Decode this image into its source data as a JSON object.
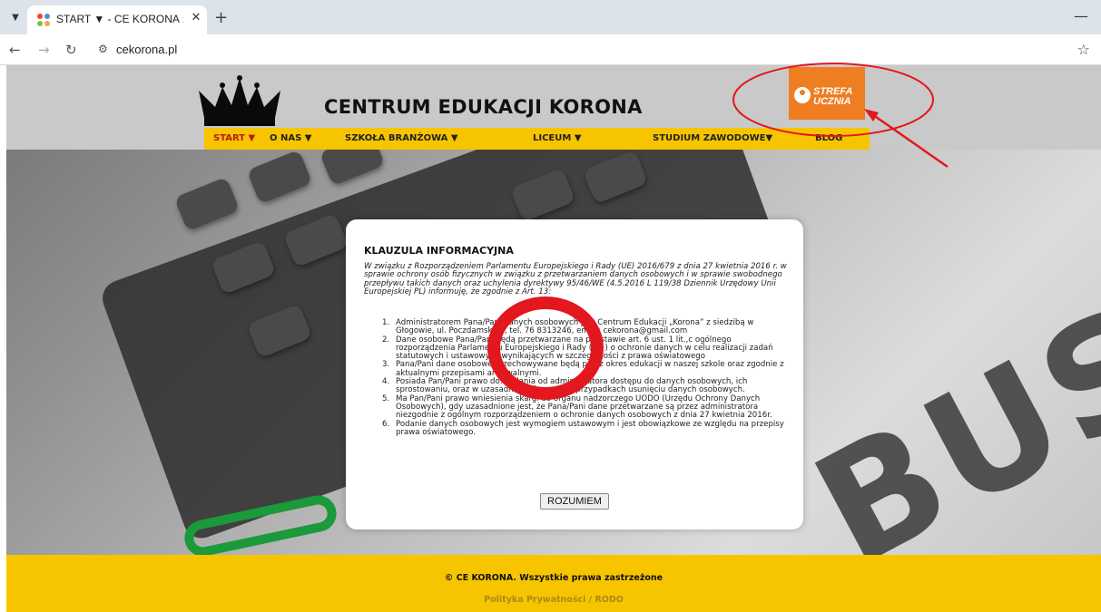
{
  "browser": {
    "tab_title": "START ▼ - CE KORONA :: CENT",
    "url": "cekorona.pl",
    "tab_menu_icon": "chevron-down-icon",
    "close_icon": "close-icon",
    "new_tab_icon": "plus-icon",
    "back_icon": "back-arrow-icon",
    "forward_icon": "forward-arrow-icon",
    "reload_icon": "reload-icon",
    "site_info_icon": "site-settings-icon",
    "bookmark_icon": "star-icon",
    "minimize_icon": "minimize-icon"
  },
  "header": {
    "title": "CENTRUM EDUKACJI KORONA",
    "strefa_line1": "STREFA",
    "strefa_line2": "UCZNIA",
    "logo_icon": "crown-icon",
    "user_icon": "user-icon"
  },
  "nav": {
    "items": [
      {
        "label": "START ▼"
      },
      {
        "label": "O NAS ▼"
      },
      {
        "label": "SZKOŁA BRANŻOWA ▼"
      },
      {
        "label": "LICEUM ▼"
      },
      {
        "label": "STUDIUM ZAWODOWE▼"
      },
      {
        "label": "BLOG"
      }
    ]
  },
  "hero": {
    "background_text": "BUSI"
  },
  "modal": {
    "title": "KLAUZULA INFORMACYJNA",
    "intro": "W związku z Rozporządzeniem Parlamentu Europejskiego i Rady (UE) 2016/679 z dnia 27 kwietnia 2016 r. w sprawie ochrony osób fizycznych w związku z przetwarzaniem danych osobowych i w sprawie swobodnego przepływu takich danych oraz uchylenia dyrektywy 95/46/WE (4.5.2016 L 119/38 Dziennik Urzędowy Unii Europejskiej PL) informuję, że zgodnie z Art. 13:",
    "items": [
      {
        "num": "1.",
        "text": "Administratorem Pana/Pani danych osobowych jest Centrum Edukacji „Korona” z siedzibą w Głogowie, ul. Poczdamska 1, tel. 76 8313246, email: cekorona@gmail.com"
      },
      {
        "num": "2.",
        "text": "Dane osobowe Pana/Pani będą przetwarzane na podstawie art. 6 ust. 1 lit.,c ogólnego rozporządzenia Parlamentu Europejskiego i Rady (UE ) o ochronie danych w celu realizacji zadań statutowych i ustawowych wynikających w szczególności z prawa oświatowego"
      },
      {
        "num": "3.",
        "text": "Pana/Pani dane osobowe przechowywane będą przez okres edukacji w naszej szkole oraz zgodnie z aktualnymi przepisami archiwalnymi."
      },
      {
        "num": "4.",
        "text": "Posiada Pan/Pani prawo do: żądania od administratora dostępu do danych osobowych, ich sprostowaniu, oraz w uzasadnionych prawem przypadkach usunięciu danych osobowych."
      },
      {
        "num": "5.",
        "text": "Ma Pan/Pani prawo wniesienia skargi do organu nadzorczego UODO (Urzędu Ochrony Danych Osobowych), gdy uzasadnione jest, że Pana/Pani dane przetwarzane są przez administratora niezgodnie z ogólnym rozporządzeniem o ochronie danych osobowych z dnia 27 kwietnia 2016r."
      },
      {
        "num": "6.",
        "text": "Podanie danych osobowych jest wymogiem ustawowym i jest obowiązkowe ze względu na przepisy prawa oświatowego."
      }
    ],
    "button": "ROZUMIEM"
  },
  "footer": {
    "copyright": "© CE KORONA. Wszystkie prawa zastrzeżone",
    "privacy_link": "Polityka Prywatności / RODO"
  },
  "colors": {
    "accent_yellow": "#f7c500",
    "strefa_orange": "#ef7d22",
    "annotation_red": "#e3171e"
  }
}
